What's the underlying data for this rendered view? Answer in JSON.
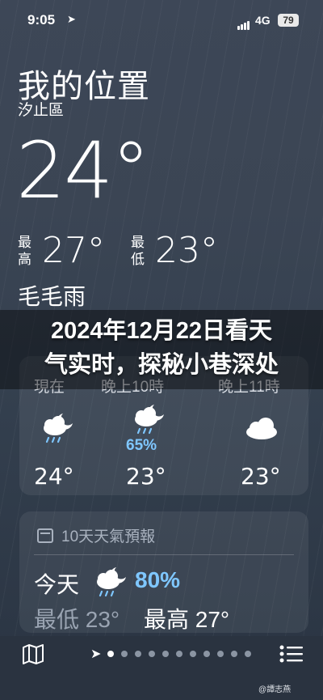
{
  "status": {
    "time": "9:05",
    "network": "4G",
    "battery": "79"
  },
  "location": {
    "title": "我的位置",
    "district": "汐止區"
  },
  "current": {
    "temp": "24°",
    "condition": "毛毛雨"
  },
  "high_low": {
    "high_label": "最\n高",
    "high": "27°",
    "low_label": "最\n低",
    "low": "23°"
  },
  "headline": {
    "line1": "2024年12月22日看天",
    "line2": "气实时，探秘小巷深处"
  },
  "hourly": {
    "items": [
      {
        "label": "現在",
        "icon": "rain-moon-icon",
        "precip": "",
        "temp": "24°"
      },
      {
        "label": "晚上10時",
        "icon": "rain-moon-icon",
        "precip": "65%",
        "temp": "23°"
      },
      {
        "label": "晚上11時",
        "icon": "cloud-icon",
        "precip": "",
        "temp": "23°"
      }
    ]
  },
  "forecast": {
    "header": "10天天氣預報",
    "today": {
      "day": "今天",
      "precip": "80%",
      "low": "最低 23°",
      "high": "最高 27°"
    }
  },
  "watermark": "@譚志燕",
  "colors": {
    "accent": "#7fc7ff",
    "background": "#3b4554"
  }
}
